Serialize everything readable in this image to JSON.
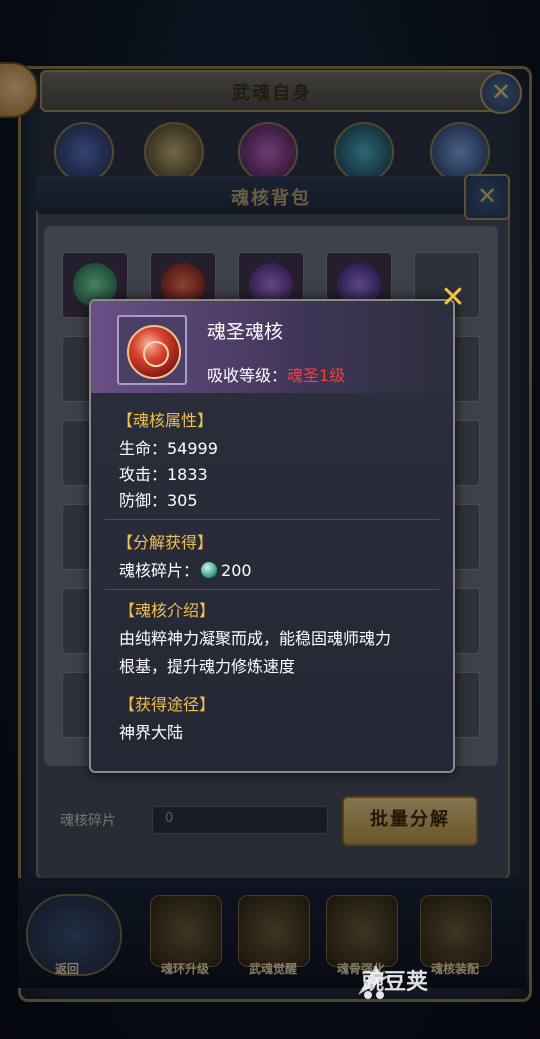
{
  "background_window": {
    "title": "武魂自身",
    "bag_title": "魂核背包",
    "footer_label": "魂核碎片",
    "footer_value": "0",
    "batch_button": "批量分解",
    "bottom_nav": [
      "返回",
      "魂环升级",
      "武魂觉醒",
      "魂骨强化",
      "魂核装配"
    ]
  },
  "popup": {
    "item_name": "魂圣魂核",
    "absorb_label": "吸收等级：",
    "absorb_value": "魂圣1级",
    "attr_title": "【魂核属性】",
    "attrs": [
      "生命：54999",
      "攻击：1833",
      "防御：305"
    ],
    "decompose_title": "【分解获得】",
    "decompose_label": "魂核碎片：",
    "decompose_value": "200",
    "intro_title": "【魂核介绍】",
    "intro_line1": "由纯粹神力凝聚而成，能稳固魂师魂力",
    "intro_line2": "根基，提升魂力修炼速度",
    "source_title": "【获得途径】",
    "source_text": "神界大陆"
  },
  "watermark": "豌豆荚",
  "colors": {
    "accent_gold": "#f0c04d",
    "level_red": "#ff3a3a",
    "popup_bg": "#2b2f3c"
  }
}
